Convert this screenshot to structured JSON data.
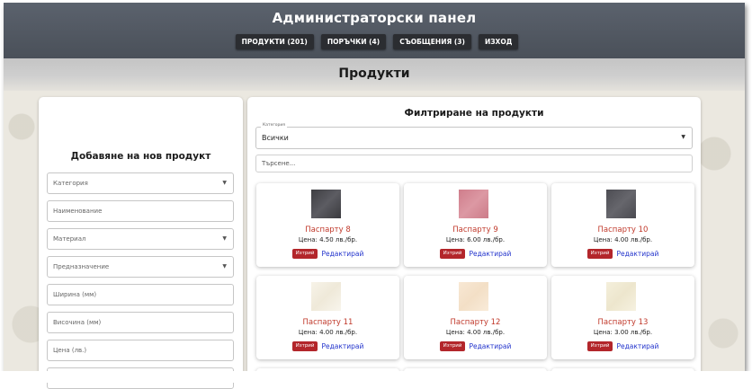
{
  "header": {
    "title": "Администраторски панел",
    "nav": [
      {
        "label": "ПРОДУКТИ (201)"
      },
      {
        "label": "ПОРЪЧКИ (4)"
      },
      {
        "label": "СЪОБЩЕНИЯ (3)"
      },
      {
        "label": "ИЗХОД"
      }
    ]
  },
  "section": {
    "title": "Продукти"
  },
  "add_form": {
    "title": "Добавяне на нов продукт",
    "fields": [
      {
        "label": "Категория",
        "type": "select"
      },
      {
        "label": "Наименование",
        "type": "text"
      },
      {
        "label": "Материал",
        "type": "select"
      },
      {
        "label": "Предназначение",
        "type": "select"
      },
      {
        "label": "Ширина (мм)",
        "type": "text"
      },
      {
        "label": "Височина (мм)",
        "type": "text"
      },
      {
        "label": "Цена (лв.)",
        "type": "text"
      }
    ]
  },
  "filter": {
    "title": "Филтриране на продукти",
    "category_label": "Категория",
    "category_value": "Всички",
    "search_placeholder": "Търсене..."
  },
  "products": [
    {
      "name": "Паспарту 8",
      "price": "Цена: 4.50 лв./бр.",
      "swatch_color": "#4a4a4e"
    },
    {
      "name": "Паспарту 9",
      "price": "Цена: 6.00 лв./бр.",
      "swatch_color": "#d68b97"
    },
    {
      "name": "Паспарту 10",
      "price": "Цена: 4.00 лв./бр.",
      "swatch_color": "#58585e"
    },
    {
      "name": "Паспарту 11",
      "price": "Цена: 4.00 лв./бр.",
      "swatch_color": "#f4efe2"
    },
    {
      "name": "Паспарту 12",
      "price": "Цена: 4.00 лв./бр.",
      "swatch_color": "#f6e4cf"
    },
    {
      "name": "Паспарту 13",
      "price": "Цена: 3.00 лв./бр.",
      "swatch_color": "#f2ecd6"
    }
  ],
  "card_actions": {
    "delete_label": "Изтрий",
    "edit_label": "Редактирай"
  },
  "colors": {
    "header_bg": "#4a5059",
    "accent_red": "#b3262b",
    "link_blue": "#2233cc"
  }
}
